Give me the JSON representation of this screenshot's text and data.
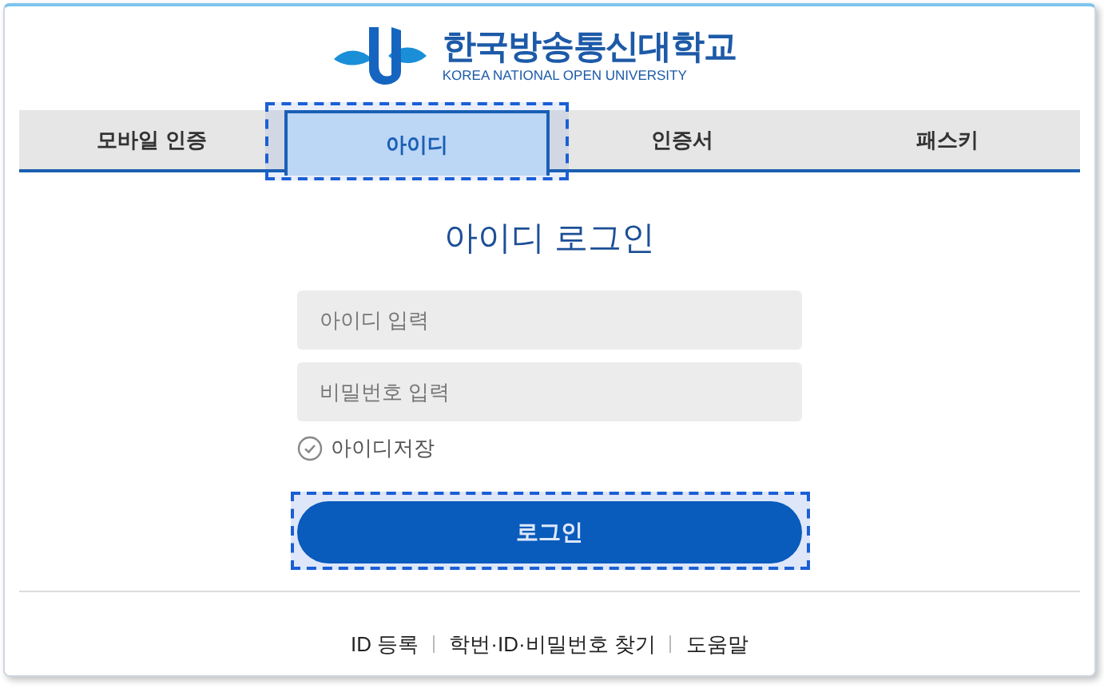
{
  "logo": {
    "name": "한국방송통신대학교",
    "subtitle": "KOREA NATIONAL OPEN UNIVERSITY"
  },
  "tabs": [
    {
      "label": "모바일 인증",
      "selected": false,
      "highlighted": false
    },
    {
      "label": "아이디",
      "selected": true,
      "highlighted": true
    },
    {
      "label": "인증서",
      "selected": false,
      "highlighted": false
    },
    {
      "label": "패스키",
      "selected": false,
      "highlighted": false
    }
  ],
  "title": "아이디 로그인",
  "fields": [
    {
      "placeholder": "아이디 입력"
    },
    {
      "placeholder": "비밀번호 입력"
    }
  ],
  "save_id": {
    "label": "아이디저장",
    "checked": false
  },
  "login_button": {
    "label": "로그인",
    "highlighted": true
  },
  "footer_links": [
    "ID 등록",
    "학번·ID·비밀번호 찾기",
    "도움말"
  ]
}
